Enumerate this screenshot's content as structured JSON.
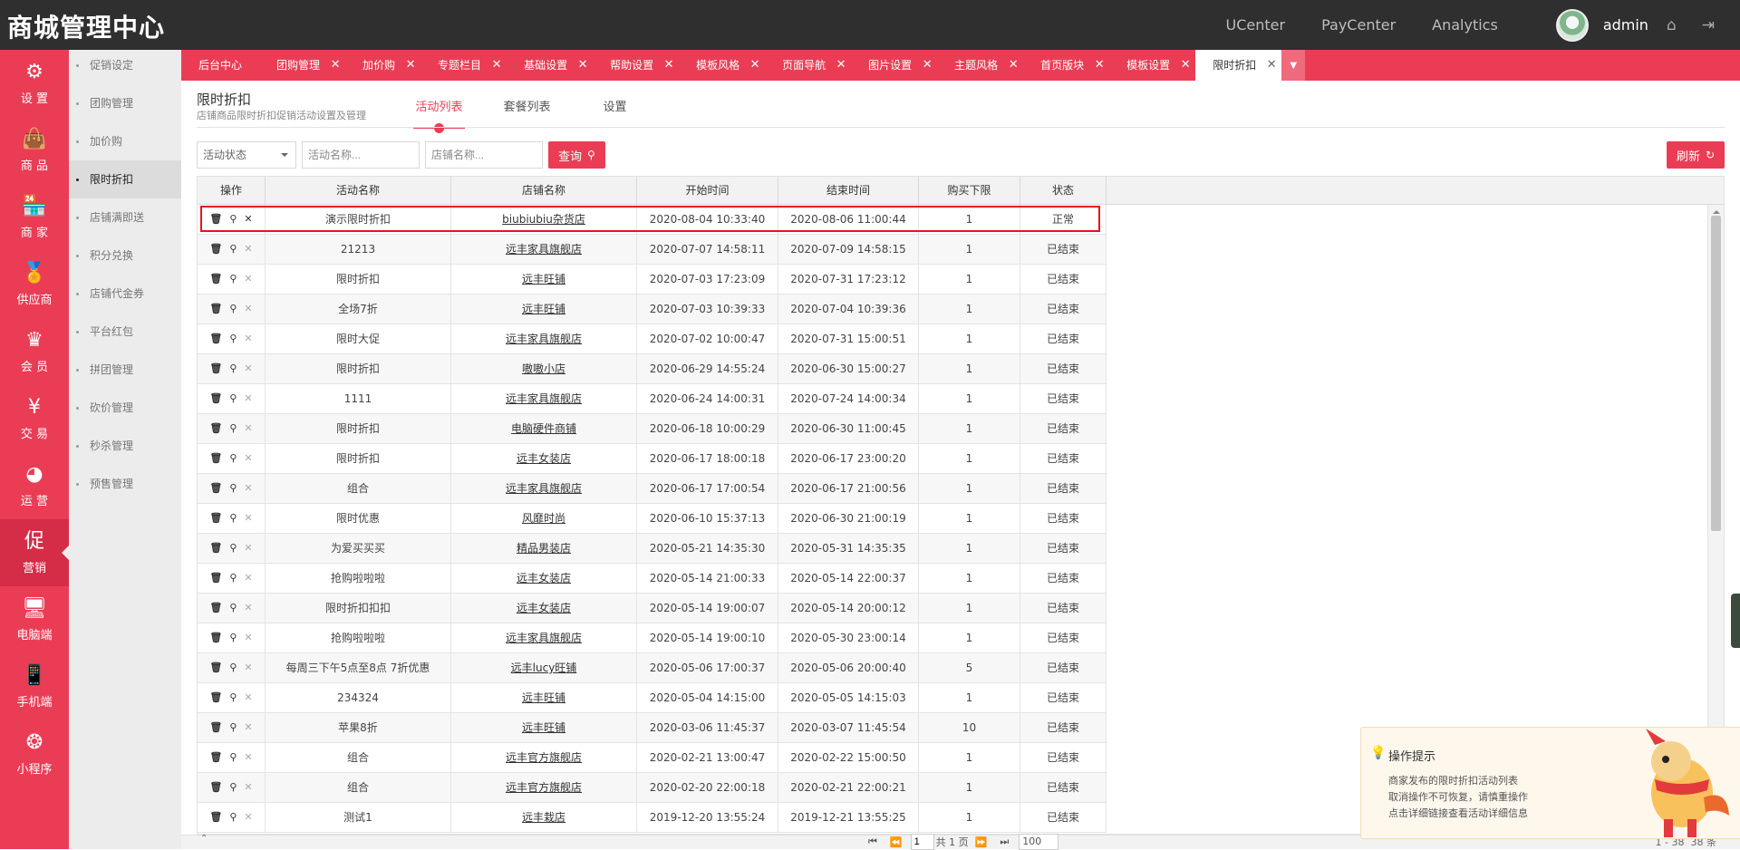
{
  "app": {
    "brand": "商城管理中心"
  },
  "topnav": {
    "items": [
      "UCenter",
      "PayCenter",
      "Analytics"
    ],
    "user": "admin"
  },
  "side1": [
    {
      "icon": "gear-icon",
      "glyph": "⚙",
      "label": "设 置"
    },
    {
      "icon": "shopping-bag-icon",
      "glyph": "👜",
      "label": "商 品"
    },
    {
      "icon": "store-icon",
      "glyph": "🏪",
      "label": "商 家"
    },
    {
      "icon": "medal-icon",
      "glyph": "🏅",
      "label": "供应商"
    },
    {
      "icon": "crown-icon",
      "glyph": "♛",
      "label": "会 员"
    },
    {
      "icon": "yen-icon",
      "glyph": "¥",
      "label": "交 易"
    },
    {
      "icon": "pie-chart-icon",
      "glyph": "◕",
      "label": "运 营"
    },
    {
      "icon": "promo-icon",
      "glyph": "促",
      "label": "营销"
    },
    {
      "icon": "monitor-icon",
      "glyph": "🖥",
      "label": "电脑端"
    },
    {
      "icon": "mobile-icon",
      "glyph": "📱",
      "label": "手机端"
    },
    {
      "icon": "miniprogram-icon",
      "glyph": "❂",
      "label": "小程序"
    }
  ],
  "side2": [
    "促销设定",
    "团购管理",
    "加价购",
    "限时折扣",
    "店铺满即送",
    "积分兑换",
    "店铺代金券",
    "平台红包",
    "拼团管理",
    "砍价管理",
    "秒杀管理",
    "预售管理"
  ],
  "tabs": [
    "后台中心",
    "团购管理",
    "加价购",
    "专题栏目",
    "基础设置",
    "帮助设置",
    "模板风格",
    "页面导航",
    "图片设置",
    "主题风格",
    "首页版块",
    "模板设置",
    "限时折扣"
  ],
  "page": {
    "title": "限时折扣",
    "desc": "店铺商品限时折扣促销活动设置及管理",
    "subtabs": [
      "活动列表",
      "套餐列表",
      "设置"
    ]
  },
  "filters": {
    "status": "活动状态",
    "name_placeholder": "活动名称...",
    "shop_placeholder": "店铺名称...",
    "query": "查询",
    "refresh": "刷新"
  },
  "table": {
    "columns": [
      "操作",
      "活动名称",
      "店铺名称",
      "开始时间",
      "结束时间",
      "购买下限",
      "状态"
    ],
    "rows": [
      [
        "演示限时折扣",
        "biubiubiu杂货店",
        "2020-08-04 10:33:40",
        "2020-08-06 11:00:44",
        "1",
        "正常"
      ],
      [
        "21213",
        "远丰家具旗舰店",
        "2020-07-07 14:58:11",
        "2020-07-09 14:58:15",
        "1",
        "已结束"
      ],
      [
        "限时折扣",
        "远丰旺铺",
        "2020-07-03 17:23:09",
        "2020-07-31 17:23:12",
        "1",
        "已结束"
      ],
      [
        "全场7折",
        "远丰旺铺",
        "2020-07-03 10:39:33",
        "2020-07-04 10:39:36",
        "1",
        "已结束"
      ],
      [
        "限时大促",
        "远丰家具旗舰店",
        "2020-07-02 10:00:47",
        "2020-07-31 15:00:51",
        "1",
        "已结束"
      ],
      [
        "限时折扣",
        "嗷嗷小店",
        "2020-06-29 14:55:24",
        "2020-06-30 15:00:27",
        "1",
        "已结束"
      ],
      [
        "1111",
        "远丰家具旗舰店",
        "2020-06-24 14:00:31",
        "2020-07-24 14:00:34",
        "1",
        "已结束"
      ],
      [
        "限时折扣",
        "电脑硬件商铺",
        "2020-06-18 10:00:29",
        "2020-06-30 11:00:45",
        "1",
        "已结束"
      ],
      [
        "限时折扣",
        "远丰女装店",
        "2020-06-17 18:00:18",
        "2020-06-17 23:00:20",
        "1",
        "已结束"
      ],
      [
        "组合",
        "远丰家具旗舰店",
        "2020-06-17 17:00:54",
        "2020-06-17 21:00:56",
        "1",
        "已结束"
      ],
      [
        "限时优惠",
        "风靡时尚",
        "2020-06-10 15:37:13",
        "2020-06-30 21:00:19",
        "1",
        "已结束"
      ],
      [
        "为爱买买买",
        "精品男装店",
        "2020-05-21 14:35:30",
        "2020-05-31 14:35:35",
        "1",
        "已结束"
      ],
      [
        "抢购啦啦啦",
        "远丰女装店",
        "2020-05-14 21:00:33",
        "2020-05-14 22:00:37",
        "1",
        "已结束"
      ],
      [
        "限时折扣扣扣",
        "远丰女装店",
        "2020-05-14 19:00:07",
        "2020-05-14 20:00:12",
        "1",
        "已结束"
      ],
      [
        "抢购啦啦啦",
        "远丰家具旗舰店",
        "2020-05-14 19:00:10",
        "2020-05-30 23:00:14",
        "1",
        "已结束"
      ],
      [
        "每周三下午5点至8点 7折优惠",
        "远丰lucy旺铺",
        "2020-05-06 17:00:37",
        "2020-05-06 20:00:40",
        "5",
        "已结束"
      ],
      [
        "234324",
        "远丰旺铺",
        "2020-05-04 14:15:00",
        "2020-05-05 14:15:03",
        "1",
        "已结束"
      ],
      [
        "苹果8折",
        "远丰旺铺",
        "2020-03-06 11:45:37",
        "2020-03-07 11:45:54",
        "10",
        "已结束"
      ],
      [
        "组合",
        "远丰官方旗舰店",
        "2020-02-21 13:00:47",
        "2020-02-22 15:00:50",
        "1",
        "已结束"
      ],
      [
        "组合",
        "远丰官方旗舰店",
        "2020-02-20 22:00:18",
        "2020-02-21 22:00:21",
        "1",
        "已结束"
      ],
      [
        "测试1",
        "远丰栽店",
        "2019-12-20 13:55:24",
        "2019-12-21 13:55:25",
        "1",
        "已结束"
      ]
    ]
  },
  "pager": {
    "page": "1",
    "total_pages": "共 1 页",
    "page_size": "100",
    "count": "1 - 38",
    "total": "38 条"
  },
  "tip": {
    "title": "操作提示",
    "lines": [
      "商家发布的限时折扣活动列表",
      "取消操作不可恢复，请慎重操作",
      "点击详细链接查看活动详细信息"
    ]
  }
}
